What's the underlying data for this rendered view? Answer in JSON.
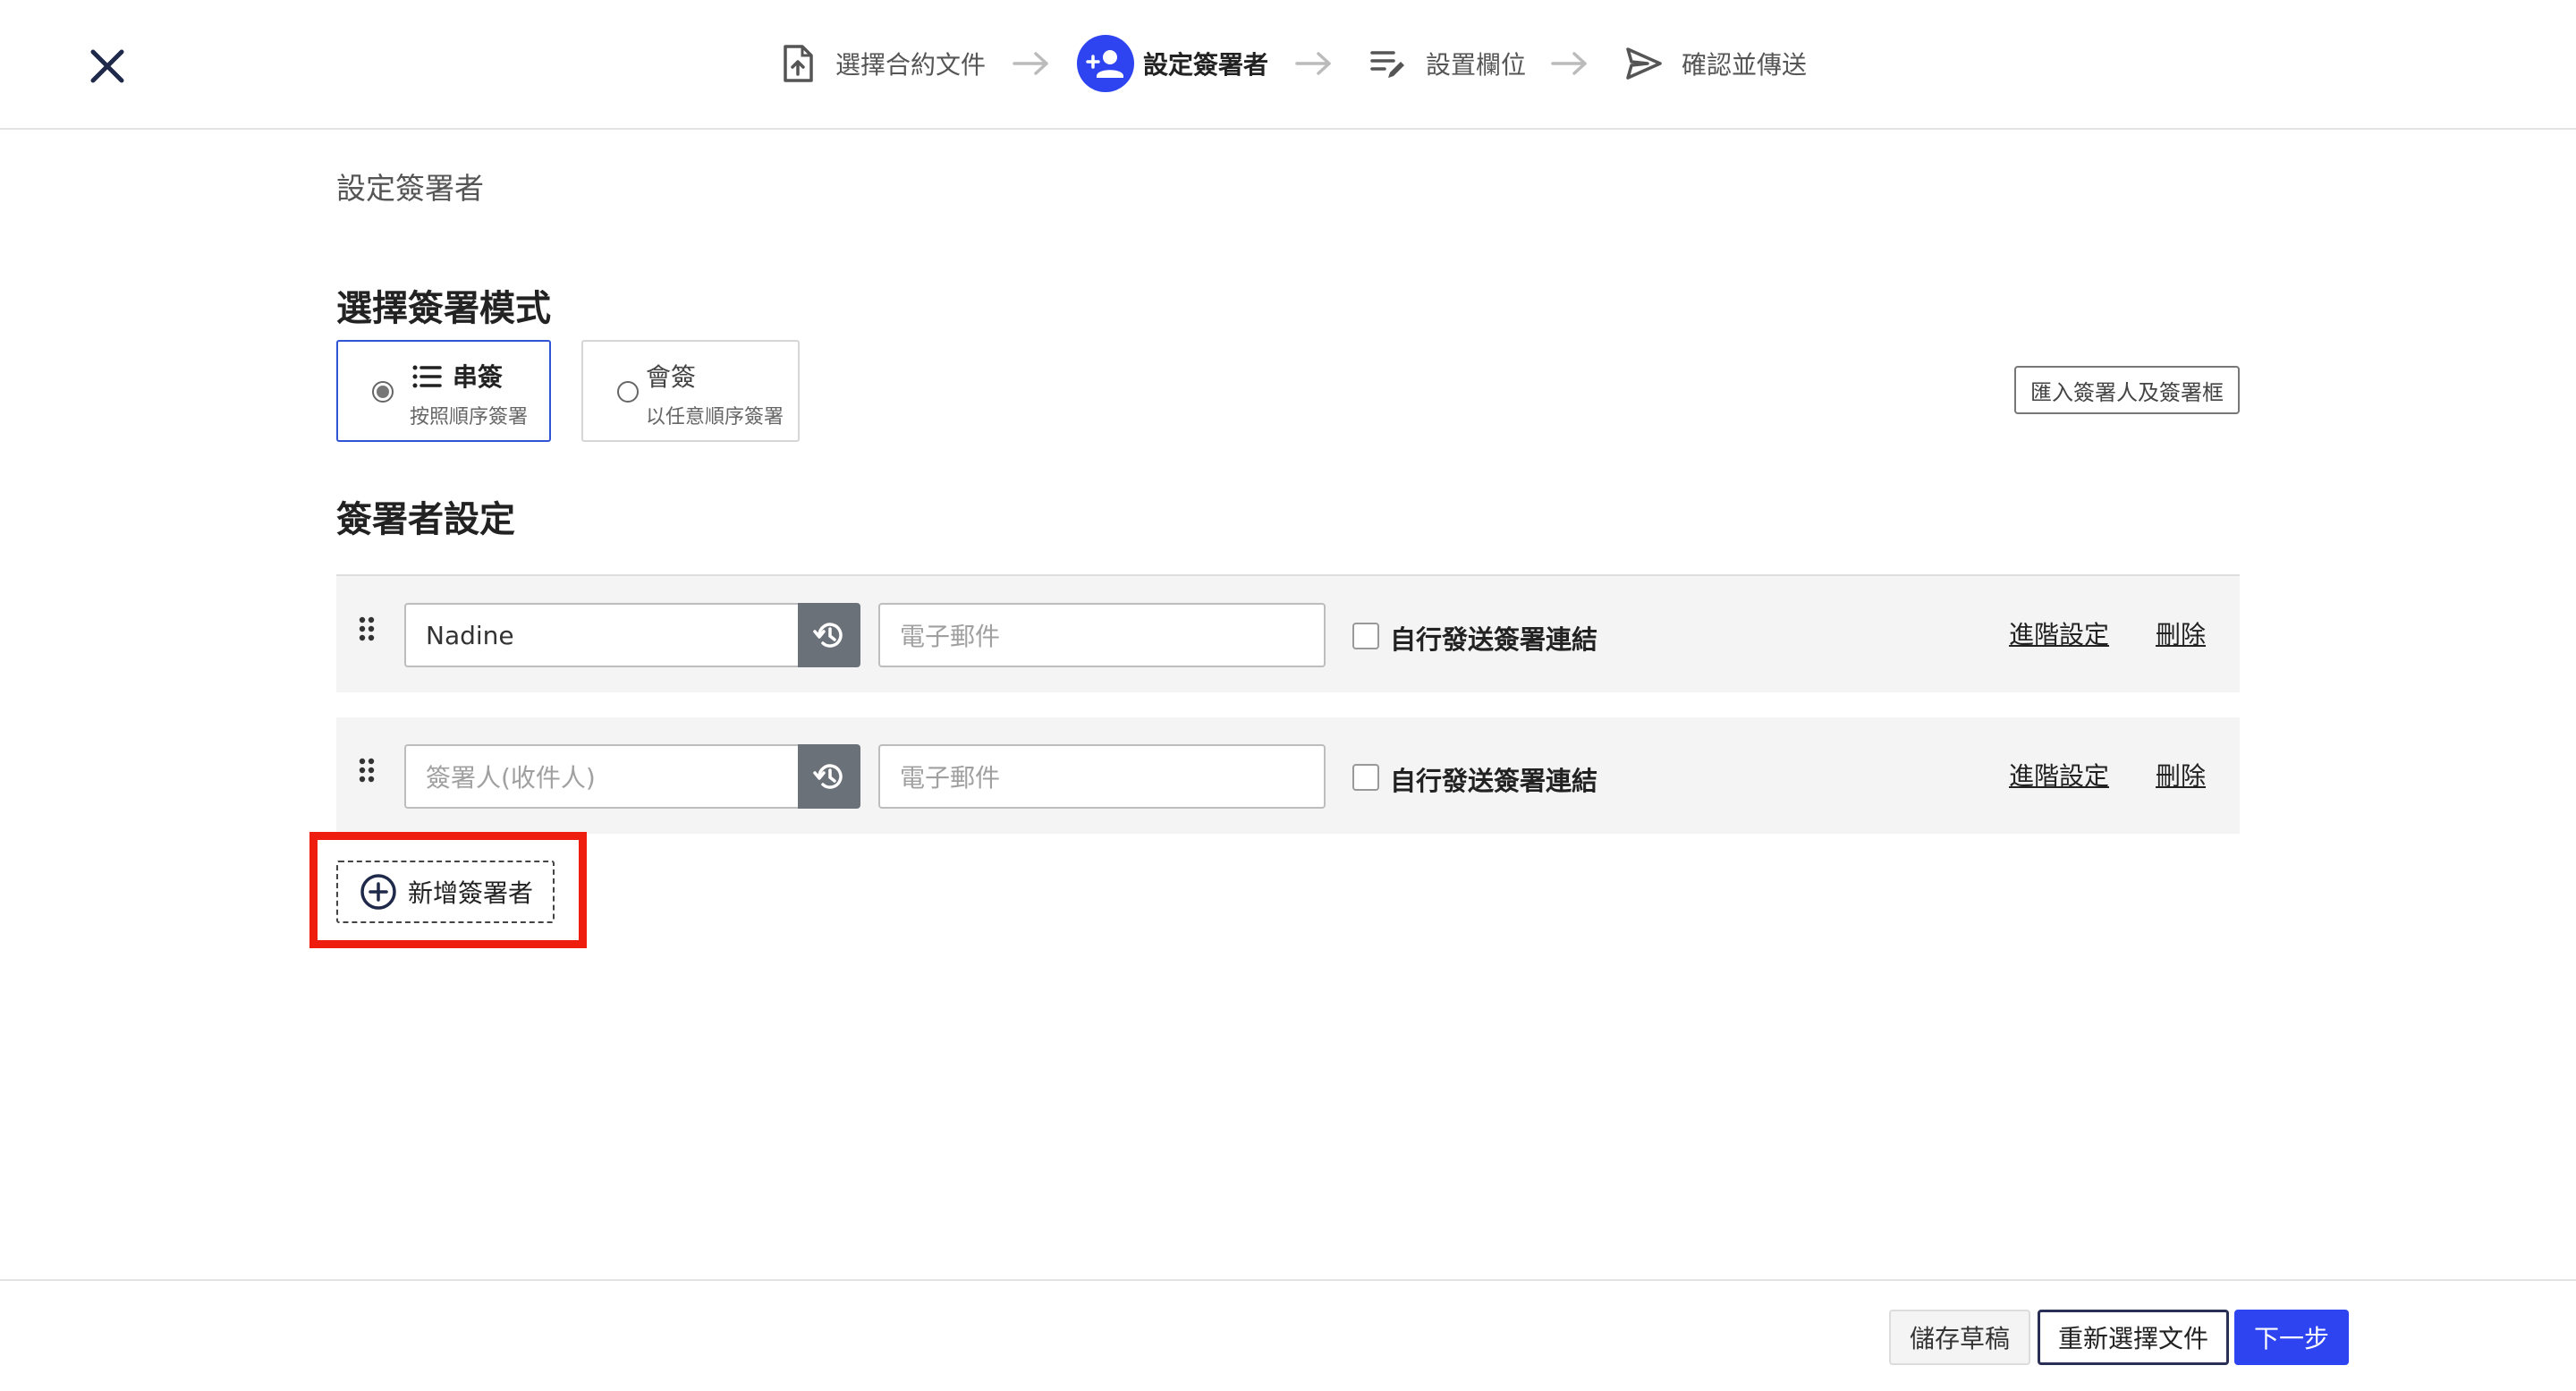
{
  "header": {
    "steps": [
      {
        "label": "選擇合約文件",
        "icon": "file-upload-icon",
        "active": false
      },
      {
        "label": "設定簽署者",
        "icon": "person-add-icon",
        "active": true
      },
      {
        "label": "設置欄位",
        "icon": "edit-fields-icon",
        "active": false
      },
      {
        "label": "確認並傳送",
        "icon": "send-icon",
        "active": false
      }
    ],
    "accent_color": "#2d44f0"
  },
  "main": {
    "page_title": "設定簽署者",
    "mode_section_title": "選擇簽署模式",
    "modes": [
      {
        "title": "串簽",
        "subtitle": "按照順序簽署",
        "selected": true
      },
      {
        "title": "會簽",
        "subtitle": "以任意順序簽署",
        "selected": false
      }
    ],
    "import_button": "匯入簽署人及簽署框",
    "signer_section_title": "簽署者設定",
    "signers": [
      {
        "name": "Nadine",
        "email_placeholder": "電子郵件",
        "self_send_label": "自行發送簽署連結",
        "self_send_checked": false,
        "advanced_link": "進階設定",
        "delete_link": "刪除"
      },
      {
        "name_placeholder": "簽署人(收件人)",
        "email_placeholder": "電子郵件",
        "self_send_label": "自行發送簽署連結",
        "self_send_checked": false,
        "advanced_link": "進階設定",
        "delete_link": "刪除"
      }
    ],
    "add_signer_button": "新增簽署者",
    "highlight_color": "#ef1d0e"
  },
  "footer": {
    "save_draft": "儲存草稿",
    "reselect_document": "重新選擇文件",
    "next": "下一步"
  }
}
